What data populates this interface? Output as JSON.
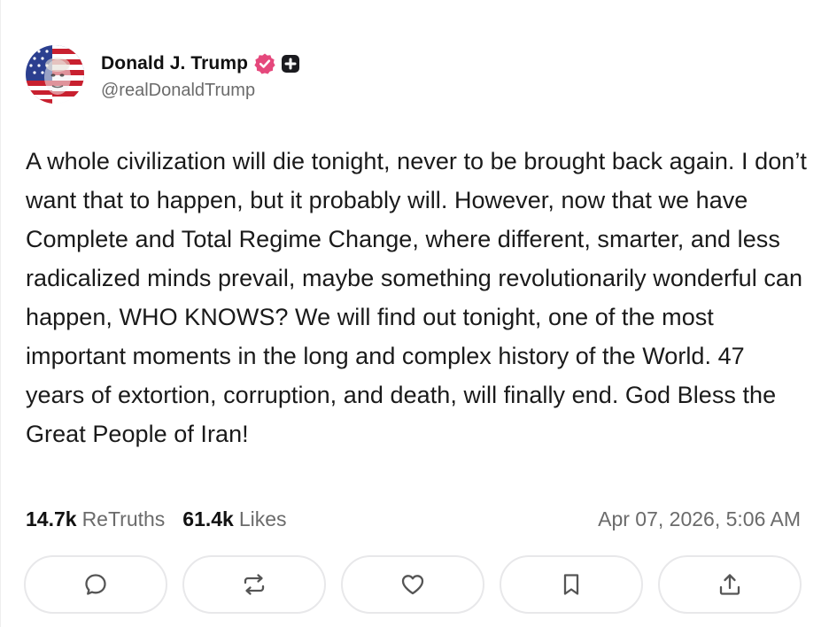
{
  "post": {
    "author": {
      "display_name": "Donald J. Trump",
      "handle": "@realDonaldTrump",
      "avatar_icon": "avatar-flag-portrait",
      "verified_icon": "verified-badge-icon",
      "verified_color": "#e5487c",
      "plus_icon": "plus-badge-icon"
    },
    "body": "A whole civilization will die tonight, never to be brought back again. I don’t want that to happen, but it probably will. However, now that we have Complete and Total Regime Change, where different, smarter, and less radicalized minds prevail, maybe something revolutionarily wonderful can happen, WHO KNOWS? We will find out tonight, one of the most important moments in the long and complex history of the World. 47 years of extortion, corruption, and death, will finally end. God Bless the Great People of Iran!",
    "stats": {
      "retruths_count": "14.7k",
      "retruths_label": "ReTruths",
      "likes_count": "61.4k",
      "likes_label": "Likes"
    },
    "timestamp": "Apr 07, 2026, 5:06 AM"
  },
  "actions": [
    {
      "icon": "reply-icon"
    },
    {
      "icon": "retruth-icon"
    },
    {
      "icon": "like-icon"
    },
    {
      "icon": "bookmark-icon"
    },
    {
      "icon": "share-icon"
    }
  ],
  "colors": {
    "text": "#111111",
    "muted": "#6b6b6b",
    "border": "#e8e8ea",
    "icon": "#555555"
  }
}
